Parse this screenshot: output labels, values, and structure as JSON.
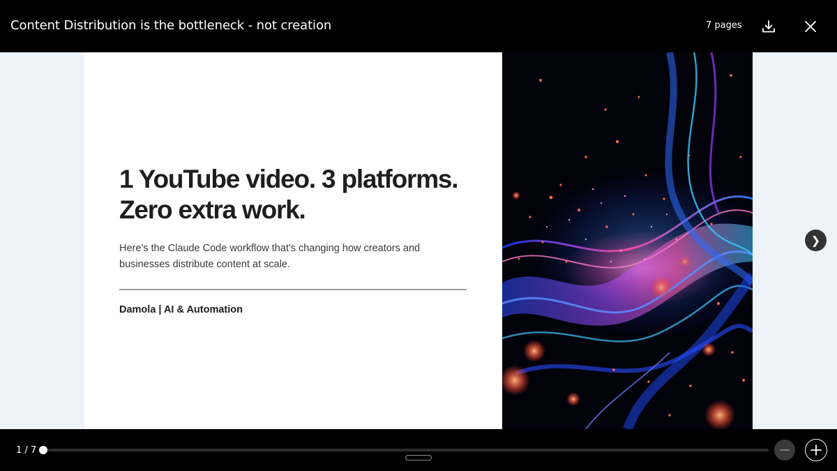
{
  "header": {
    "title": "Content Distribution is the bottleneck - not creation",
    "page_count_label": "7 pages",
    "download_icon": "download-icon",
    "close_icon": "close-icon"
  },
  "slide": {
    "headline_line1": "1 YouTube video. 3 platforms.",
    "headline_line2": "Zero extra work.",
    "subtitle_line1": "Here's the Claude Code workflow that's changing how creators and",
    "subtitle_line2": "businesses distribute content at scale.",
    "author": "Damola | AI & Automation",
    "image_icon": "abstract-particle-wave-image"
  },
  "navigation": {
    "next_glyph": "❯",
    "next_icon": "chevron-right-icon"
  },
  "footer": {
    "page_indicator": "1 / 7",
    "current_page": 1,
    "total_pages": 7,
    "zoom_out_icon": "minus-icon",
    "zoom_in_icon": "plus-icon"
  },
  "colors": {
    "chrome_background": "#000000",
    "viewer_background": "#eef2f9",
    "slide_background": "#ffffff",
    "headline": "#1e1e1e",
    "art_pink": "#ff4fa8",
    "art_blue": "#2f6bff",
    "art_cyan": "#39c8ff",
    "art_purple": "#9b3bff"
  }
}
